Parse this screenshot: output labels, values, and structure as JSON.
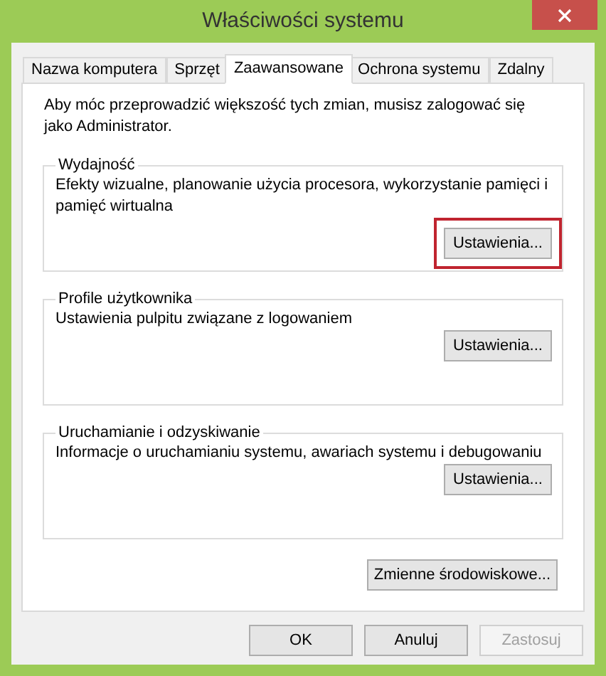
{
  "window": {
    "title": "Właściwości systemu"
  },
  "tabs": [
    {
      "label": "Nazwa komputera",
      "selected": false
    },
    {
      "label": "Sprzęt",
      "selected": false
    },
    {
      "label": "Zaawansowane",
      "selected": true
    },
    {
      "label": "Ochrona systemu",
      "selected": false
    },
    {
      "label": "Zdalny",
      "selected": false
    }
  ],
  "notice": "Aby móc przeprowadzić większość tych zmian, musisz zalogować się jako Administrator.",
  "groups": [
    {
      "title": "Wydajność",
      "description": "Efekty wizualne, planowanie użycia procesora, wykorzystanie pamięci i pamięć wirtualna",
      "button": "Ustawienia...",
      "highlighted": true
    },
    {
      "title": "Profile użytkownika",
      "description": "Ustawienia pulpitu związane z logowaniem",
      "button": "Ustawienia...",
      "highlighted": false
    },
    {
      "title": "Uruchamianie i odzyskiwanie",
      "description": "Informacje o uruchamianiu systemu, awariach systemu i debugowaniu",
      "button": "Ustawienia...",
      "highlighted": false
    }
  ],
  "env_button": "Zmienne środowiskowe...",
  "buttons": [
    {
      "label": "OK",
      "disabled": false
    },
    {
      "label": "Anuluj",
      "disabled": false
    },
    {
      "label": "Zastosuj",
      "disabled": true
    }
  ]
}
